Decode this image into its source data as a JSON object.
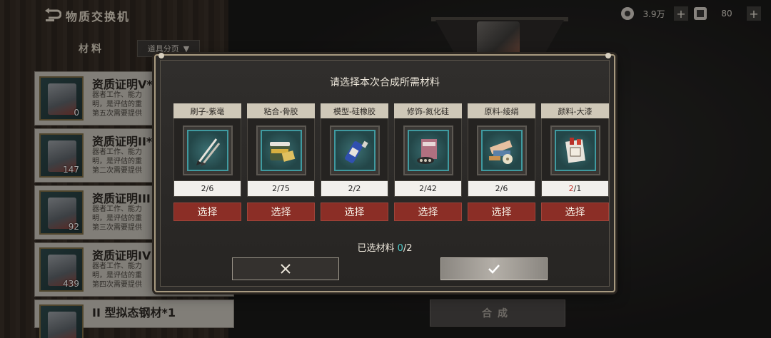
{
  "header": {
    "title": "物质交换机"
  },
  "currency": {
    "coin_value": "3.9万",
    "ticket_value": "80"
  },
  "left_panel": {
    "section_label": "材料",
    "filter_label": "道具分页",
    "items": [
      {
        "name": "资质证明V*",
        "count": "0",
        "desc": [
          "器者工作、能力",
          "明，是评估的重",
          "第五次需要提供"
        ]
      },
      {
        "name": "资质证明II*",
        "count": "147",
        "desc": [
          "器者工作、能力",
          "明，是评估的重",
          "第二次需要提供"
        ]
      },
      {
        "name": "资质证明III",
        "count": "92",
        "desc": [
          "器者工作、能力",
          "明，是评估的重",
          "第三次需要提供"
        ]
      },
      {
        "name": "资质证明IV",
        "count": "439",
        "desc": [
          "器者工作、能力",
          "明，是评估的重",
          "第四次需要提供"
        ]
      },
      {
        "name": "II 型拟态钢材*1",
        "count": "",
        "desc": []
      }
    ]
  },
  "compose_button": "合成",
  "dialog": {
    "title": "请选择本次合成所需材料",
    "slots": [
      {
        "label": "刷子-紫毫",
        "have": "2",
        "need": "6",
        "short": false,
        "icon": "brush-icon",
        "button": "选择"
      },
      {
        "label": "粘合-骨胶",
        "have": "2",
        "need": "75",
        "short": false,
        "icon": "glue-jar-icon",
        "button": "选择"
      },
      {
        "label": "模型-硅橡胶",
        "have": "2",
        "need": "2",
        "short": false,
        "icon": "silicone-tube-icon",
        "button": "选择"
      },
      {
        "label": "修饰-氮化硅",
        "have": "2",
        "need": "42",
        "short": false,
        "icon": "powder-packet-icon",
        "button": "选择"
      },
      {
        "label": "原料-绫绢",
        "have": "2",
        "need": "6",
        "short": false,
        "icon": "silk-roll-icon",
        "button": "选择"
      },
      {
        "label": "颜料-大漆",
        "have": "2",
        "need": "1",
        "short": true,
        "icon": "lacquer-pack-icon",
        "button": "选择"
      }
    ],
    "selected_label": "已选材料",
    "selected_current": "0",
    "selected_total": "2"
  },
  "colors": {
    "select_button": "#8b2e26",
    "accent_teal": "#4fc9c9",
    "shortage_red": "#c0302a"
  }
}
